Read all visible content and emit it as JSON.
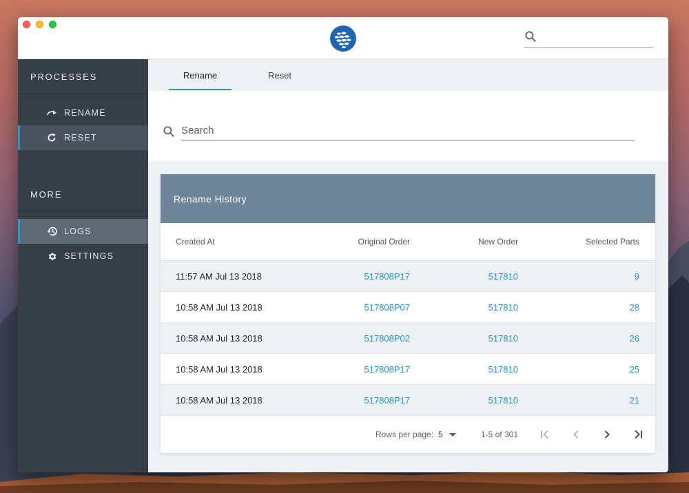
{
  "app": {
    "colors": {
      "accent": "#2196d3",
      "sidebar": "#363e48",
      "card_header": "#6e8499",
      "link": "#1b97cf"
    },
    "logo_icon": "sail-logo-icon"
  },
  "topbar": {
    "search_icon": "search-icon"
  },
  "sidebar": {
    "processes_title": "PROCESSES",
    "processes": [
      {
        "label": "RENAME",
        "icon": "redo-arrow-icon"
      },
      {
        "label": "RESET",
        "icon": "refresh-icon"
      }
    ],
    "more_title": "MORE",
    "more": [
      {
        "label": "LOGS",
        "icon": "history-icon"
      },
      {
        "label": "SETTINGS",
        "icon": "gear-icon"
      }
    ]
  },
  "tabs": [
    {
      "label": "Rename",
      "active": true
    },
    {
      "label": "Reset",
      "active": false
    }
  ],
  "search": {
    "placeholder": "Search",
    "value": ""
  },
  "table": {
    "title": "Rename History",
    "columns": [
      "Created At",
      "Original Order",
      "New Order",
      "Selected Parts"
    ],
    "rows": [
      {
        "created": "11:57 AM Jul 13 2018",
        "original": "517808P17",
        "new": "517810",
        "parts": "9"
      },
      {
        "created": "10:58 AM Jul 13 2018",
        "original": "517808P07",
        "new": "517810",
        "parts": "28"
      },
      {
        "created": "10:58 AM Jul 13 2018",
        "original": "517808P02",
        "new": "517810",
        "parts": "26"
      },
      {
        "created": "10:58 AM Jul 13 2018",
        "original": "517808P17",
        "new": "517810",
        "parts": "25"
      },
      {
        "created": "10:58 AM Jul 13 2018",
        "original": "517808P17",
        "new": "517810",
        "parts": "21"
      }
    ],
    "footer": {
      "rows_per_page_label": "Rows per page:",
      "rows_per_page_value": "5",
      "range": "1-5 of 301"
    }
  }
}
